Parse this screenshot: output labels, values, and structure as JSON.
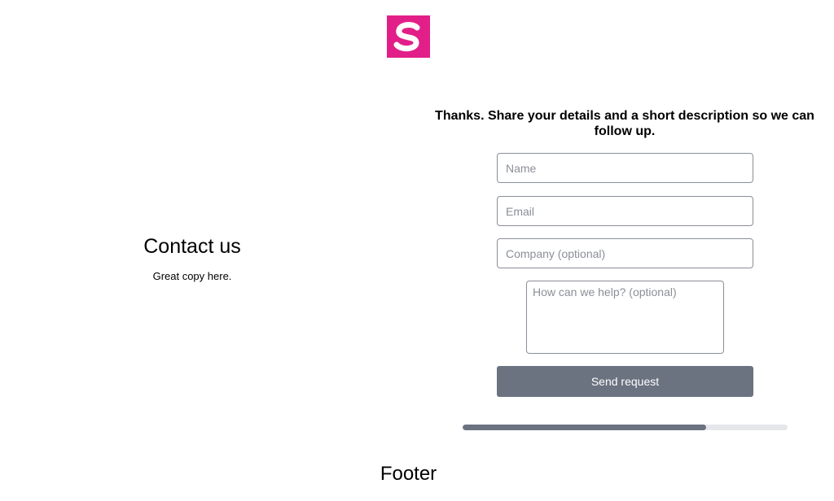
{
  "logo": {
    "letter": "S",
    "color": "#e21f88"
  },
  "intro": {
    "title": "Contact us",
    "copy": "Great copy here."
  },
  "form": {
    "heading": "Thanks. Share your details and a short description so we can follow up.",
    "name_placeholder": "Name",
    "email_placeholder": "Email",
    "company_placeholder": "Company (optional)",
    "help_placeholder": "How can we help? (optional)",
    "submit_label": "Send request",
    "button_color": "#6b7280"
  },
  "progress": {
    "fraction": 0.75
  },
  "footer": {
    "label": "Footer"
  }
}
